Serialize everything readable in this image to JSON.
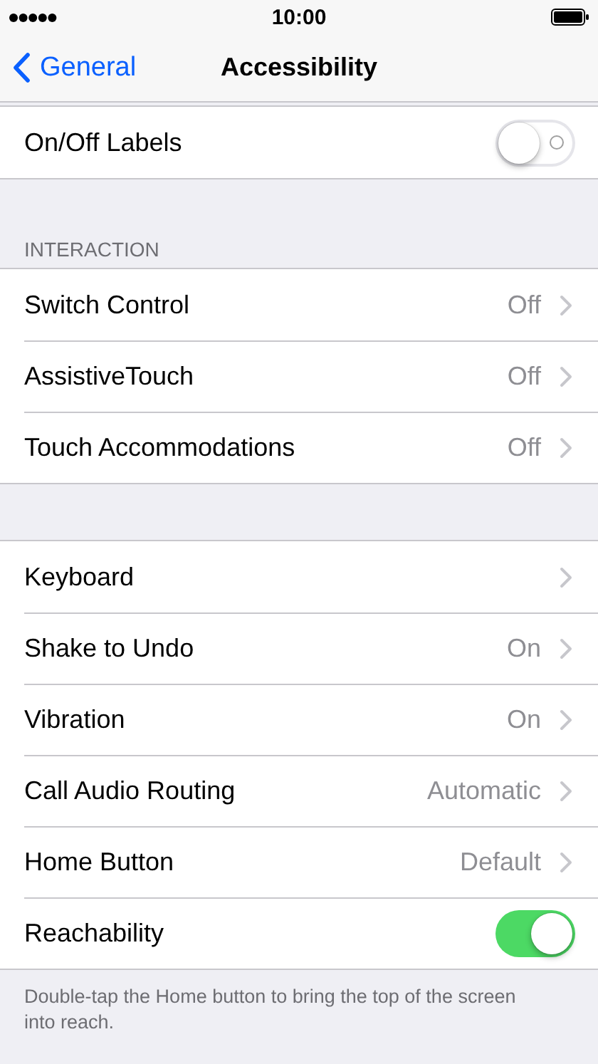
{
  "status_bar": {
    "time": "10:00"
  },
  "nav": {
    "back": "General",
    "title": "Accessibility"
  },
  "groups": [
    {
      "rows": [
        {
          "kind": "toggle",
          "label": "On/Off Labels",
          "on": false
        }
      ]
    },
    {
      "header": "INTERACTION",
      "rows": [
        {
          "kind": "link",
          "label": "Switch Control",
          "value": "Off"
        },
        {
          "kind": "link",
          "label": "AssistiveTouch",
          "value": "Off"
        },
        {
          "kind": "link",
          "label": "Touch Accommodations",
          "value": "Off"
        }
      ]
    },
    {
      "rows": [
        {
          "kind": "link",
          "label": "Keyboard"
        },
        {
          "kind": "link",
          "label": "Shake to Undo",
          "value": "On"
        },
        {
          "kind": "link",
          "label": "Vibration",
          "value": "On"
        },
        {
          "kind": "link",
          "label": "Call Audio Routing",
          "value": "Automatic"
        },
        {
          "kind": "link",
          "label": "Home Button",
          "value": "Default"
        },
        {
          "kind": "toggle",
          "label": "Reachability",
          "on": true
        }
      ],
      "footer": "Double-tap the Home button to bring the top of the screen into reach."
    }
  ]
}
